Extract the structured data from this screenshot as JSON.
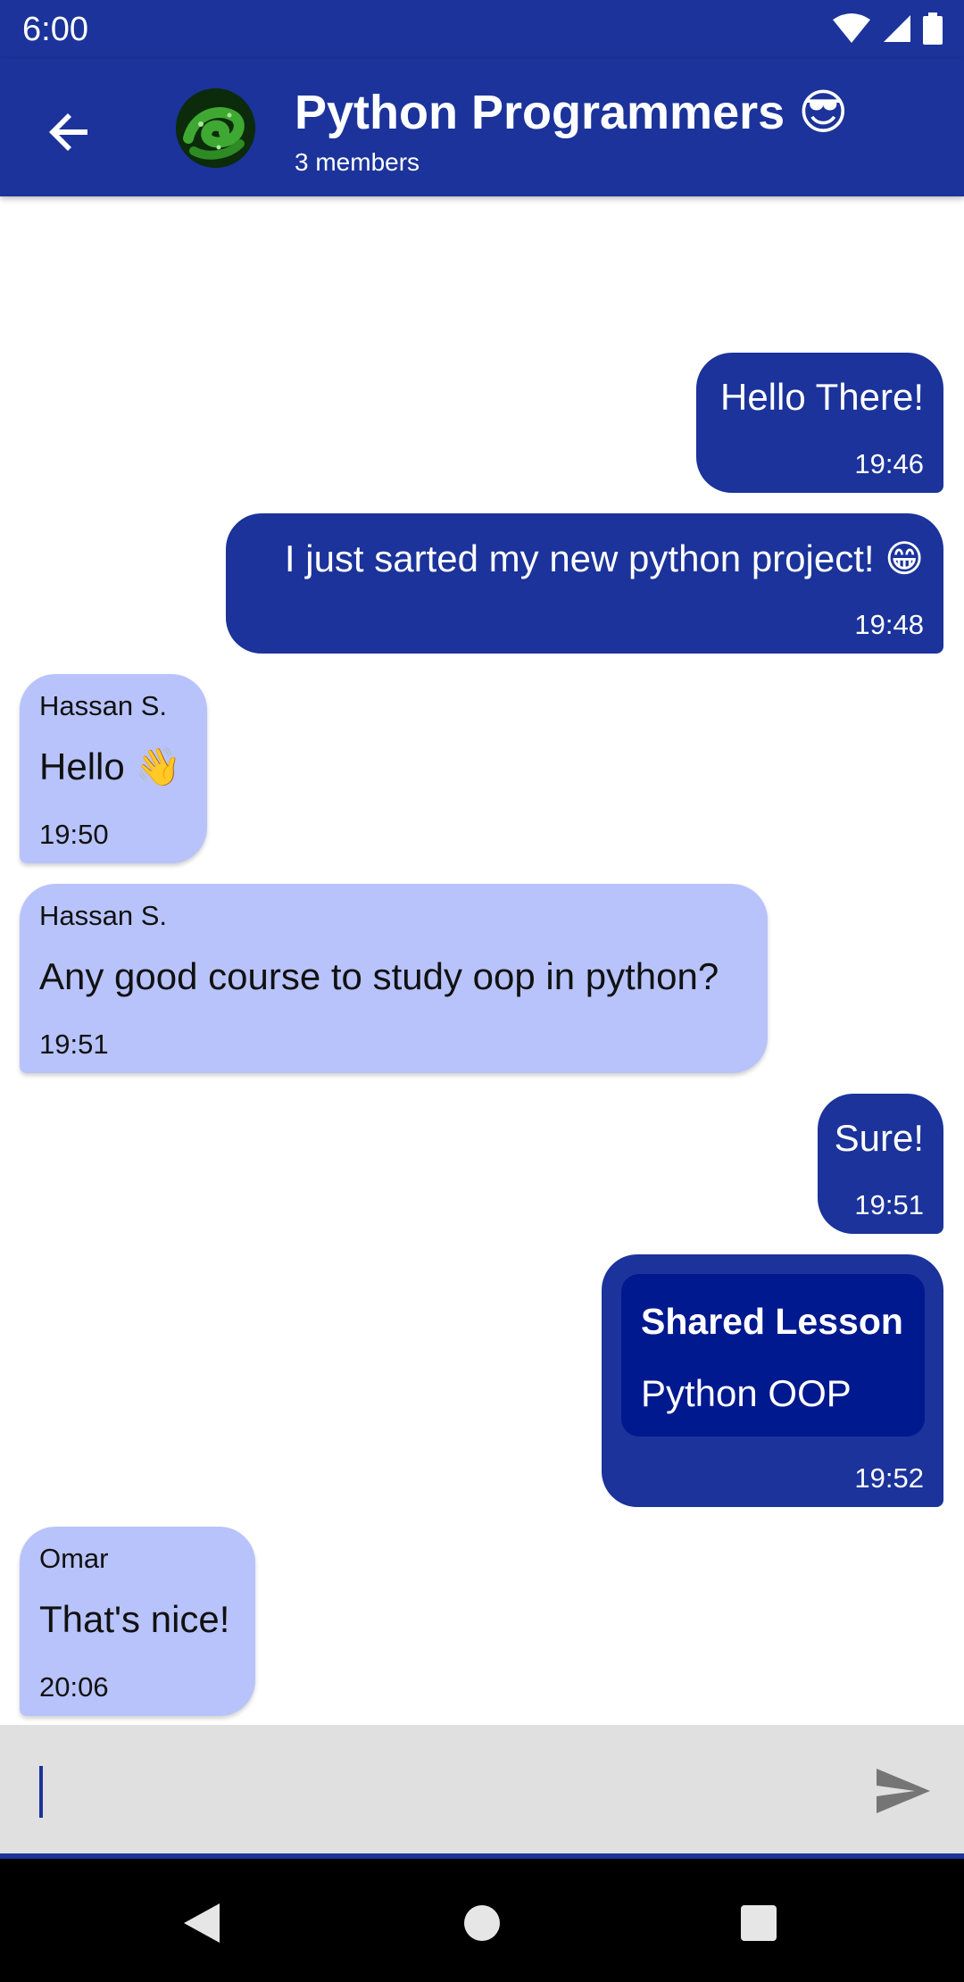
{
  "status_bar": {
    "time": "6:00",
    "icons": [
      "wifi-icon",
      "signal-icon",
      "battery-icon"
    ]
  },
  "app_bar": {
    "back_icon": "arrow-left-icon",
    "avatar": "python-snake-avatar",
    "title": "Python Programmers 😎",
    "subtitle": "3 members"
  },
  "messages": [
    {
      "direction": "outgoing",
      "text": "Hello There!",
      "time": "19:46"
    },
    {
      "direction": "outgoing",
      "text": "I just sarted my new python project! 😁",
      "time": "19:48"
    },
    {
      "direction": "incoming",
      "sender": "Hassan S.",
      "text": "Hello 👋",
      "time": "19:50"
    },
    {
      "direction": "incoming",
      "sender": "Hassan S.",
      "text": "Any good course to study oop in python?",
      "time": "19:51"
    },
    {
      "direction": "outgoing",
      "text": "Sure!",
      "time": "19:51"
    },
    {
      "direction": "outgoing",
      "shared_lesson": {
        "title": "Shared Lesson",
        "name": "Python OOP"
      },
      "time": "19:52"
    },
    {
      "direction": "incoming",
      "sender": "Omar",
      "text": "That's nice!",
      "time": "20:06"
    }
  ],
  "composer": {
    "value": "",
    "placeholder": "",
    "send_icon": "send-icon"
  },
  "nav_bar": {
    "buttons": [
      "back-triangle-icon",
      "home-circle-icon",
      "recents-square-icon"
    ]
  },
  "colors": {
    "primary": "#1b339a",
    "outgoing_bubble": "#1b339a",
    "incoming_bubble": "#b8c3fc",
    "lesson_card": "#01198f",
    "composer_bg": "#e0e0e0"
  }
}
